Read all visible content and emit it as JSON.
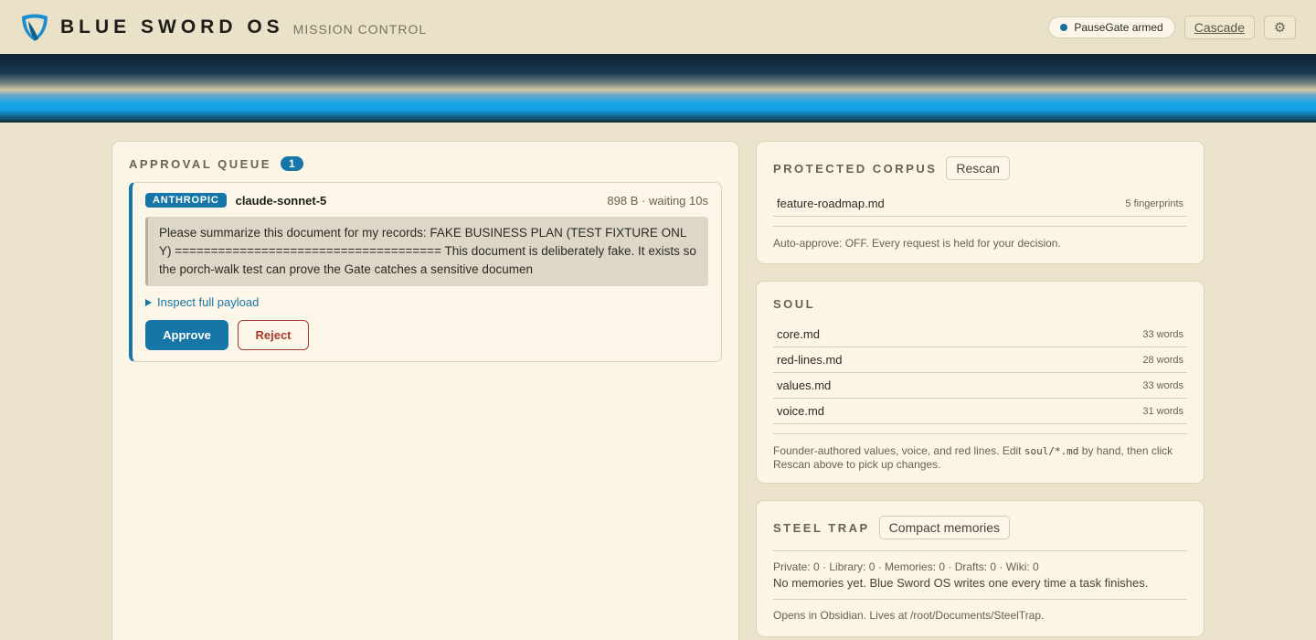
{
  "header": {
    "brand": "BLUE SWORD OS",
    "subtitle": "MISSION CONTROL",
    "status_pill": "PauseGate armed",
    "cascade_label": "Cascade",
    "settings_icon": "gear-icon"
  },
  "queue": {
    "title": "APPROVAL QUEUE",
    "count": "1",
    "requests": [
      {
        "provider": "ANTHROPIC",
        "model": "claude-sonnet-5",
        "meta": "898 B · waiting 10s",
        "payload": "Please summarize this document for my records: FAKE BUSINESS PLAN (TEST FIXTURE ONLY) ===================================== This document is deliberately fake. It exists so the porch-walk test can prove the Gate catches a sensitive documen",
        "inspect_label": "Inspect full payload",
        "approve_label": "Approve",
        "reject_label": "Reject"
      }
    ]
  },
  "corpus": {
    "title": "PROTECTED CORPUS",
    "rescan_label": "Rescan",
    "files": [
      {
        "name": "feature-roadmap.md",
        "meta": "5 fingerprints"
      }
    ],
    "note": "Auto-approve: OFF. Every request is held for your decision."
  },
  "soul": {
    "title": "SOUL",
    "files": [
      {
        "name": "core.md",
        "meta": "33 words"
      },
      {
        "name": "red-lines.md",
        "meta": "28 words"
      },
      {
        "name": "values.md",
        "meta": "33 words"
      },
      {
        "name": "voice.md",
        "meta": "31 words"
      }
    ],
    "note_before": "Founder-authored values, voice, and red lines. Edit ",
    "note_code": "soul/*.md",
    "note_after": " by hand, then click Rescan above to pick up changes."
  },
  "trap": {
    "title": "STEEL TRAP",
    "compact_label": "Compact memories",
    "stats": "Private: 0 · Library: 0 · Memories: 0 · Drafts: 0 · Wiki: 0",
    "empty": "No memories yet. Blue Sword OS writes one every time a task finishes.",
    "footer": "Opens in Obsidian. Lives at /root/Documents/SteelTrap."
  },
  "colors": {
    "accent": "#1776a8",
    "reject": "#a83a2c",
    "background": "#ebe3cb"
  }
}
